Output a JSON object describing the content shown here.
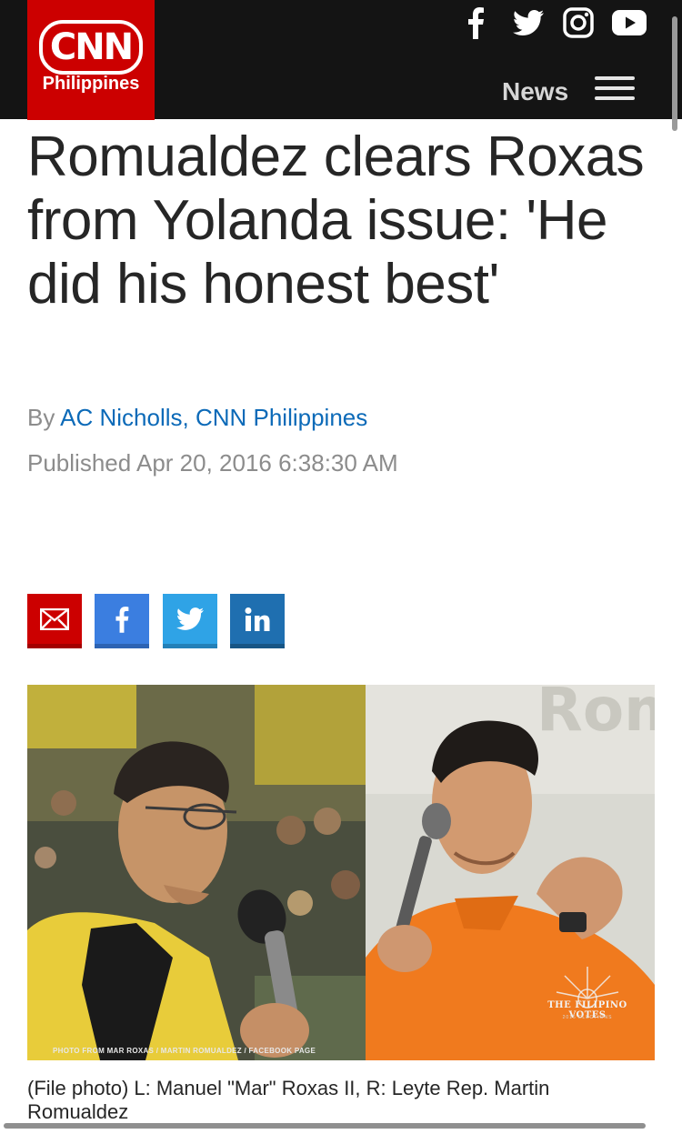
{
  "header": {
    "logo_mark": "CNN",
    "logo_sub": "Philippines",
    "nav_label": "News",
    "social_icons": [
      "facebook-icon",
      "twitter-icon",
      "instagram-icon",
      "youtube-icon"
    ],
    "menu_icon": "hamburger-menu-icon"
  },
  "article": {
    "headline": "Romualdez clears Roxas from Yolanda issue: 'He did his honest best'",
    "byline_prefix": "By",
    "author": "AC Nicholls, CNN Philippines",
    "published": "Published Apr 20, 2016 6:38:30 AM"
  },
  "share": {
    "icons": [
      "email-icon",
      "facebook-icon",
      "twitter-icon",
      "linkedin-icon"
    ]
  },
  "photo": {
    "credit": "PHOTO FROM MAR ROXAS / MARTIN ROMUALDEZ / FACEBOOK PAGE",
    "watermark": "THE FILIPINO VOTES",
    "watermark_sub": "2016 ELECTIONS",
    "background_text": "Rom",
    "caption": "(File photo) L: Manuel \"Mar\" Roxas II, R: Leyte Rep. Martin Romualdez"
  },
  "colors": {
    "brand_red": "#cc0000",
    "header_bg": "#141414",
    "link_blue": "#0c6ab8",
    "facebook_blue": "#3b7ee0",
    "twitter_blue": "#2fa3e6",
    "linkedin_blue": "#1f6fb0",
    "orange_shirt": "#f07a1e"
  }
}
